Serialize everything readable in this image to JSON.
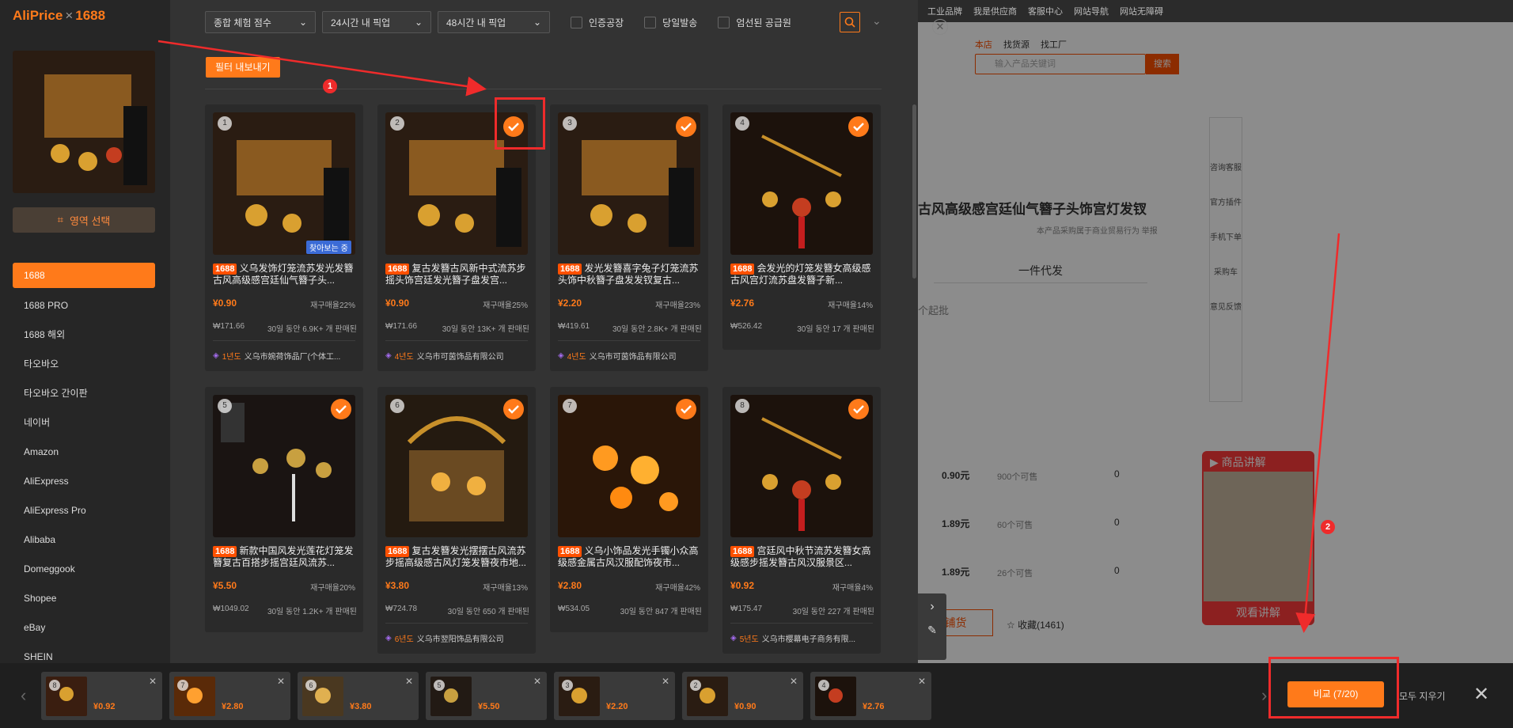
{
  "app": {
    "logo_a": "AliPrice",
    "logo_x": "×",
    "logo_b": "1688",
    "area_select": "영역 선택"
  },
  "nav": [
    "1688",
    "1688 PRO",
    "1688 해외",
    "타오바오",
    "타오바오 간이판",
    "네이버",
    "Amazon",
    "AliExpress",
    "AliExpress Pro",
    "Alibaba",
    "Domeggook",
    "Shopee",
    "eBay",
    "SHEIN"
  ],
  "filters": {
    "sort": "종합 체험 점수",
    "pickup24": "24시간 내 픽업",
    "pickup48": "48시간 내 픽업",
    "certified": "인증공장",
    "sameday": "당일발송",
    "selected": "엄선된 공급원",
    "export": "필터 내보내기"
  },
  "products": [
    {
      "n": "1",
      "tag": "1688",
      "title": "义乌发饰灯笼流苏发光发簪古风高级感宫廷仙气簪子头...",
      "price": "¥0.90",
      "rebuy": "재구매율22%",
      "krw": "₩171.66",
      "sold": "30일 동안 6.9K+ 개 판매된",
      "yr": "1년도",
      "supplier": "义乌市婉荷饰品厂(个体工...",
      "viewing": "찾아보는 중",
      "checked": false
    },
    {
      "n": "2",
      "tag": "1688",
      "title": "复古发簪古风新中式流苏步摇头饰宫廷发光簪子盘发宫...",
      "price": "¥0.90",
      "rebuy": "재구매율25%",
      "krw": "₩171.66",
      "sold": "30일 동안 13K+ 개 판매된",
      "yr": "4년도",
      "supplier": "义乌市可茵饰品有限公司",
      "checked": true
    },
    {
      "n": "3",
      "tag": "1688",
      "title": "发光发簪喜字兔子灯笼流苏头饰中秋簪子盘发发钗复古...",
      "price": "¥2.20",
      "rebuy": "재구매율23%",
      "krw": "₩419.61",
      "sold": "30일 동안 2.8K+ 개 판매된",
      "yr": "4년도",
      "supplier": "义乌市可茵饰品有限公司",
      "checked": true
    },
    {
      "n": "4",
      "tag": "1688",
      "title": "会发光的灯笼发簪女高级感古风宫灯流苏盘发簪子新...",
      "price": "¥2.76",
      "rebuy": "재구매율14%",
      "krw": "₩526.42",
      "sold": "30일 동안 17 개 판매된",
      "checked": true
    },
    {
      "n": "5",
      "tag": "1688",
      "title": "新款中国风发光莲花灯笼发簪复古百搭步摇宫廷风流苏...",
      "price": "¥5.50",
      "rebuy": "재구매율20%",
      "krw": "₩1049.02",
      "sold": "30일 동안 1.2K+ 개 판매된",
      "checked": true
    },
    {
      "n": "6",
      "tag": "1688",
      "title": "复古发簪发光摆摆古风流苏步摇高级感古风灯笼发簪夜市地...",
      "price": "¥3.80",
      "rebuy": "재구매율13%",
      "krw": "₩724.78",
      "sold": "30일 동안 650 개 판매된",
      "yr": "6년도",
      "supplier": "义乌市翌阳饰品有限公司",
      "checked": true
    },
    {
      "n": "7",
      "tag": "1688",
      "title": "义乌小饰品发光手镯小众高级感金属古风汉服配饰夜市...",
      "price": "¥2.80",
      "rebuy": "재구매율42%",
      "krw": "₩534.05",
      "sold": "30일 동안 847 개 판매된",
      "checked": true
    },
    {
      "n": "8",
      "tag": "1688",
      "title": "宫廷风中秋节流苏发簪女高级感步摇发簪古风汉服景区...",
      "price": "¥0.92",
      "rebuy": "재구매율4%",
      "krw": "₩175.47",
      "sold": "30일 동안 227 개 판매된",
      "yr": "5년도",
      "supplier": "义乌市樱幕电子商务有限...",
      "checked": true
    }
  ],
  "compare": {
    "items": [
      {
        "n": "8",
        "price": "¥0.92"
      },
      {
        "n": "7",
        "price": "¥2.80"
      },
      {
        "n": "6",
        "price": "¥3.80"
      },
      {
        "n": "5",
        "price": "¥5.50"
      },
      {
        "n": "3",
        "price": "¥2.20"
      },
      {
        "n": "2",
        "price": "¥0.90"
      },
      {
        "n": "4",
        "price": "¥2.76"
      }
    ],
    "button": "비교 (7/20)",
    "clear": "모두 지우기"
  },
  "annotations": {
    "one": "1",
    "two": "2"
  },
  "bg": {
    "topnav": [
      "工业品牌",
      "我是供应商",
      "客服中心",
      "网站导航",
      "网站无障碍"
    ],
    "search_tabs": [
      "本店",
      "找货源",
      "找工厂"
    ],
    "search_placeholder": "输入产品关键词",
    "search_btn": "搜索",
    "title": "古风高级感宫廷仙气簪子头饰宫灯发钗",
    "note": "本产品采购属于商业贸易行为",
    "report": "举报",
    "tab": "一件代发",
    "start": "个起批",
    "rows": [
      {
        "p": "0.90元",
        "s": "900个可售",
        "q": "0"
      },
      {
        "p": "1.89元",
        "s": "60个可售",
        "q": "0"
      },
      {
        "p": "1.89元",
        "s": "26个可售",
        "q": "0"
      }
    ],
    "shop": "铺货",
    "fav": "收藏(1461)",
    "tools": [
      "咨询客服",
      "官方插件",
      "手机下单",
      "采购车",
      "意见反馈"
    ],
    "video_title": "商品讲解",
    "video_btn": "观看讲解"
  }
}
